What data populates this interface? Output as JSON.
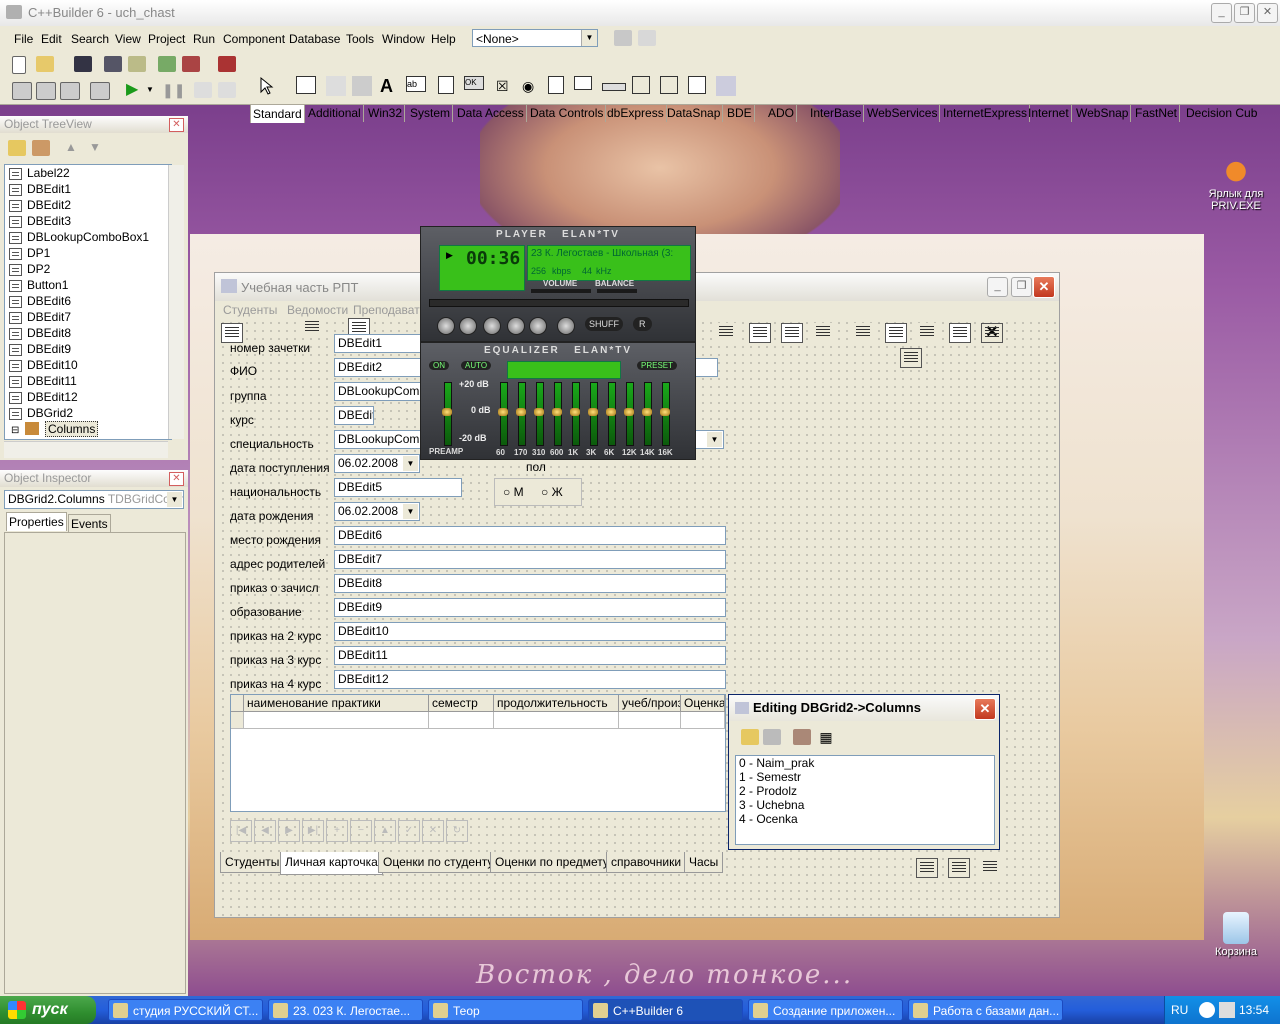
{
  "ide": {
    "title": "C++Builder 6 - uch_chast",
    "menu": [
      "File",
      "Edit",
      "Search",
      "View",
      "Project",
      "Run",
      "Component",
      "Database",
      "Tools",
      "Window",
      "Help"
    ],
    "config_combo": "<None>",
    "palette_tabs": [
      "Standard",
      "Additional",
      "Win32",
      "System",
      "Data Access",
      "Data Controls",
      "dbExpress",
      "DataSnap",
      "BDE",
      "ADO",
      "InterBase",
      "WebServices",
      "InternetExpress",
      "Internet",
      "WebSnap",
      "FastNet",
      "Decision Cub"
    ]
  },
  "tree_view": {
    "title": "Object TreeView",
    "items": [
      "Label22",
      "DBEdit1",
      "DBEdit2",
      "DBEdit3",
      "DBLookupComboBox1",
      "DP1",
      "DP2",
      "Button1",
      "DBEdit6",
      "DBEdit7",
      "DBEdit8",
      "DBEdit9",
      "DBEdit10",
      "DBEdit11",
      "DBEdit12",
      "DBGrid2",
      "Columns"
    ]
  },
  "inspector": {
    "title": "Object Inspector",
    "object_name": "DBGrid2.Columns",
    "object_type": "TDBGridColum",
    "tabs": [
      "Properties",
      "Events"
    ]
  },
  "form": {
    "title": "Учебная часть РПТ",
    "menu": [
      "Студенты",
      "Ведомости",
      "Преподавате"
    ],
    "fields": [
      {
        "label": "номер зачетки",
        "value": "DBEdit1"
      },
      {
        "label": "ФИО",
        "value": "DBEdit2"
      },
      {
        "label": "группа",
        "value": "DBLookupCombo"
      },
      {
        "label": "курс",
        "value": "DBEdit"
      },
      {
        "label": "специальность",
        "value": "DBLookupCombo"
      },
      {
        "label": "дата поступления",
        "value": "06.02.2008"
      },
      {
        "label": "национальность",
        "value": "DBEdit5"
      },
      {
        "label": "дата рождения",
        "value": "06.02.2008"
      },
      {
        "label": "место рождения",
        "value": "DBEdit6"
      },
      {
        "label": "адрес родителей",
        "value": "DBEdit7"
      },
      {
        "label": "приказ о зачисл",
        "value": "DBEdit8"
      },
      {
        "label": "образование",
        "value": "DBEdit9"
      },
      {
        "label": "приказ на 2 курс",
        "value": "DBEdit10"
      },
      {
        "label": "приказ на 3 курс",
        "value": "DBEdit11"
      },
      {
        "label": "приказ на 4 курс",
        "value": "DBEdit12"
      }
    ],
    "gender": {
      "label": "пол",
      "male": "М",
      "female": "Ж"
    },
    "grid_columns": [
      "наименование практики",
      "семестр",
      "продолжительность",
      "учеб/произ",
      "Оценка"
    ],
    "page_tabs": [
      "Студенты",
      "Личная карточка",
      "Оценки по студенту",
      "Оценки по предмету",
      "справочники",
      "Часы"
    ],
    "active_tab": "Личная карточка"
  },
  "player": {
    "title": "PLAYER",
    "brand": "ELAN*TV",
    "time": "00:36",
    "track": "23 К. Легостаев - Школьная (3:",
    "kbps": "256",
    "kbps_label": "kbps",
    "khz": "44",
    "khz_label": "kHz",
    "volume_label": "VOLUME",
    "balance_label": "BALANCE",
    "shuffle": "SHUFF",
    "repeat": "R"
  },
  "equalizer": {
    "title": "EQUALIZER",
    "brand": "ELAN*TV",
    "on": "ON",
    "auto": "AUTO",
    "preset": "PRESET",
    "db_high": "+20 dB",
    "db_mid": "0 dB",
    "db_low": "-20 dB",
    "preamp": "PREAMP",
    "bands": [
      "60",
      "170",
      "310",
      "600",
      "1K",
      "3K",
      "6K",
      "12K",
      "14K",
      "16K"
    ]
  },
  "columns_editor": {
    "title": "Editing DBGrid2->Columns",
    "items": [
      "0 - Naim_prak",
      "1 - Semestr",
      "2 - Prodolz",
      "3 - Uchebna",
      "4 - Ocenka"
    ]
  },
  "desktop": {
    "icons": [
      {
        "label": "Ярлык для PRIV.EXE"
      },
      {
        "label": "Корзина"
      }
    ],
    "caption": "Восток , дело тонкое..."
  },
  "taskbar": {
    "start": "пуск",
    "tasks": [
      "студия РУССКИЙ СТ...",
      "23. 023 К. Легостае...",
      "Теор",
      "C++Builder 6",
      "Создание приложен...",
      "Работа с базами дан..."
    ],
    "active_task": "C++Builder 6",
    "lang": "RU",
    "time": "13:54"
  }
}
